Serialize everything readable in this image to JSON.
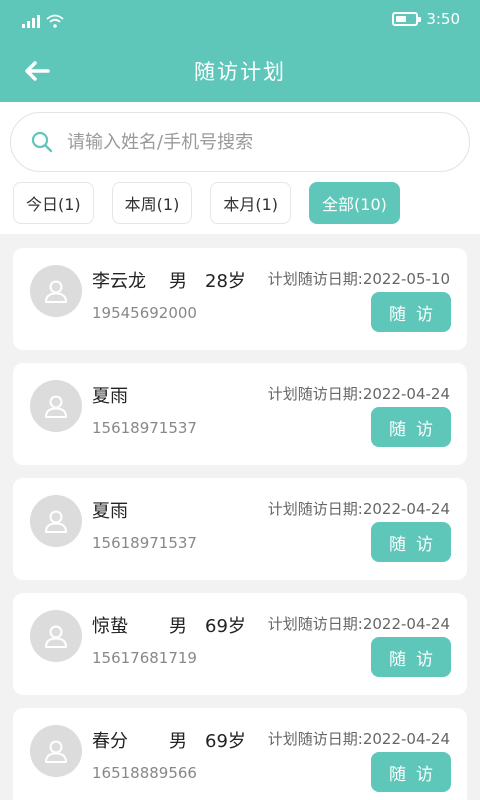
{
  "status_bar": {
    "time": "3:50"
  },
  "header": {
    "title": "随访计划"
  },
  "search": {
    "placeholder": "请输入姓名/手机号搜索",
    "value": ""
  },
  "filters": [
    {
      "label": "今日(1)",
      "active": false
    },
    {
      "label": "本周(1)",
      "active": false
    },
    {
      "label": "本月(1)",
      "active": false
    },
    {
      "label": "全部(10)",
      "active": true
    }
  ],
  "colors": {
    "accent": "#5ec7ba",
    "background": "#f2f2f2",
    "avatar": "#dcdcdc"
  },
  "patients": [
    {
      "name": "李云龙",
      "gender": "男",
      "age": "28岁",
      "phone": "19545692000",
      "date": "计划随访日期:2022-05-10",
      "button": "随访"
    },
    {
      "name": "夏雨",
      "gender": "",
      "age": "",
      "phone": "15618971537",
      "date": "计划随访日期:2022-04-24",
      "button": "随访"
    },
    {
      "name": "夏雨",
      "gender": "",
      "age": "",
      "phone": "15618971537",
      "date": "计划随访日期:2022-04-24",
      "button": "随访"
    },
    {
      "name": "惊蛰",
      "gender": "男",
      "age": "69岁",
      "phone": "15617681719",
      "date": "计划随访日期:2022-04-24",
      "button": "随访"
    },
    {
      "name": "春分",
      "gender": "男",
      "age": "69岁",
      "phone": "16518889566",
      "date": "计划随访日期:2022-04-24",
      "button": "随访"
    }
  ]
}
